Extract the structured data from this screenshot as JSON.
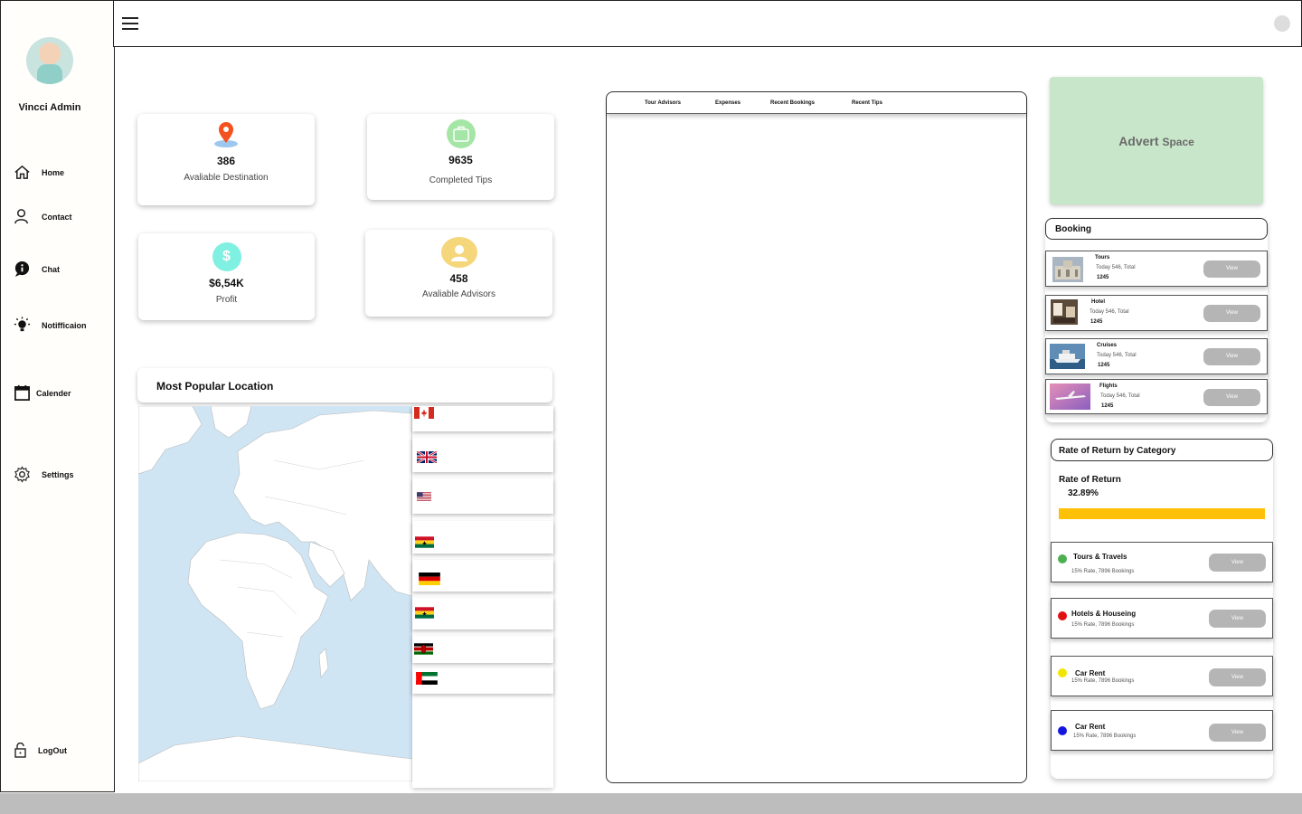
{
  "sidebar": {
    "admin_name": "Vincci Admin",
    "items": [
      {
        "label": "Home",
        "icon": "home-icon"
      },
      {
        "label": "Contact",
        "icon": "user-icon"
      },
      {
        "label": "Chat",
        "icon": "chat-icon"
      },
      {
        "label": "Notifficaion",
        "icon": "bulb-icon"
      },
      {
        "label": "Calender",
        "icon": "calendar-icon"
      },
      {
        "label": "Settings",
        "icon": "gear-icon"
      }
    ],
    "logout": "LogOut"
  },
  "stats": [
    {
      "value": "386",
      "label": "Avaliable Destination",
      "icon": "location-pin-icon",
      "color": "#f4511e"
    },
    {
      "value": "9635",
      "label": "Completed Tips",
      "icon": "suitcase-icon",
      "color": "#a5e6a6"
    },
    {
      "value": "$6,54K",
      "label": "Profit",
      "icon": "dollar-icon",
      "color": "#7ff0e1"
    },
    {
      "value": "458",
      "label": "Avaliable Advisors",
      "icon": "advisor-icon",
      "color": "#f5d67a"
    }
  ],
  "popular": {
    "title": "Most Popular Location",
    "flags": [
      "canada",
      "united-kingdom",
      "united-states",
      "ghana",
      "germany",
      "ghana",
      "kenya",
      "uae"
    ]
  },
  "tabs": [
    "Tour Advisors",
    "Expenses",
    "Recent Bookings",
    "Recent Tips"
  ],
  "advert": {
    "word1": "Advert",
    "word2": "Space"
  },
  "booking": {
    "title": "Booking",
    "items": [
      {
        "title": "Tours",
        "sub": "Today 546, Total",
        "num": "1245",
        "view": "View"
      },
      {
        "title": "Hotel",
        "sub": "Today 546, Total",
        "num": "1245",
        "view": "View"
      },
      {
        "title": "Cruises",
        "sub": "Today 546, Total",
        "num": "1245",
        "view": "View"
      },
      {
        "title": "Flights",
        "sub": "Today 546, Total",
        "num": "1245",
        "view": "View"
      }
    ]
  },
  "rate": {
    "title": "Rate of Return by Category",
    "label": "Rate of Return",
    "value": "32.89%",
    "progress_percent": 100,
    "accent": "#ffc107",
    "categories": [
      {
        "title": "Tours & Travels",
        "sub": "15% Rate, 7896 Bookings",
        "color": "#4caf50",
        "view": "View"
      },
      {
        "title": "Hotels & Houseing",
        "sub": "15% Rate, 7896 Bookings",
        "color": "#e31010",
        "view": "View"
      },
      {
        "title": "Car Rent",
        "sub": "15% Rate, 7896 Bookings",
        "color": "#f2e600",
        "view": "View"
      },
      {
        "title": "Car Rent",
        "sub": "15% Rate, 7896 Bookings",
        "color": "#1515e0",
        "view": "View"
      }
    ]
  }
}
